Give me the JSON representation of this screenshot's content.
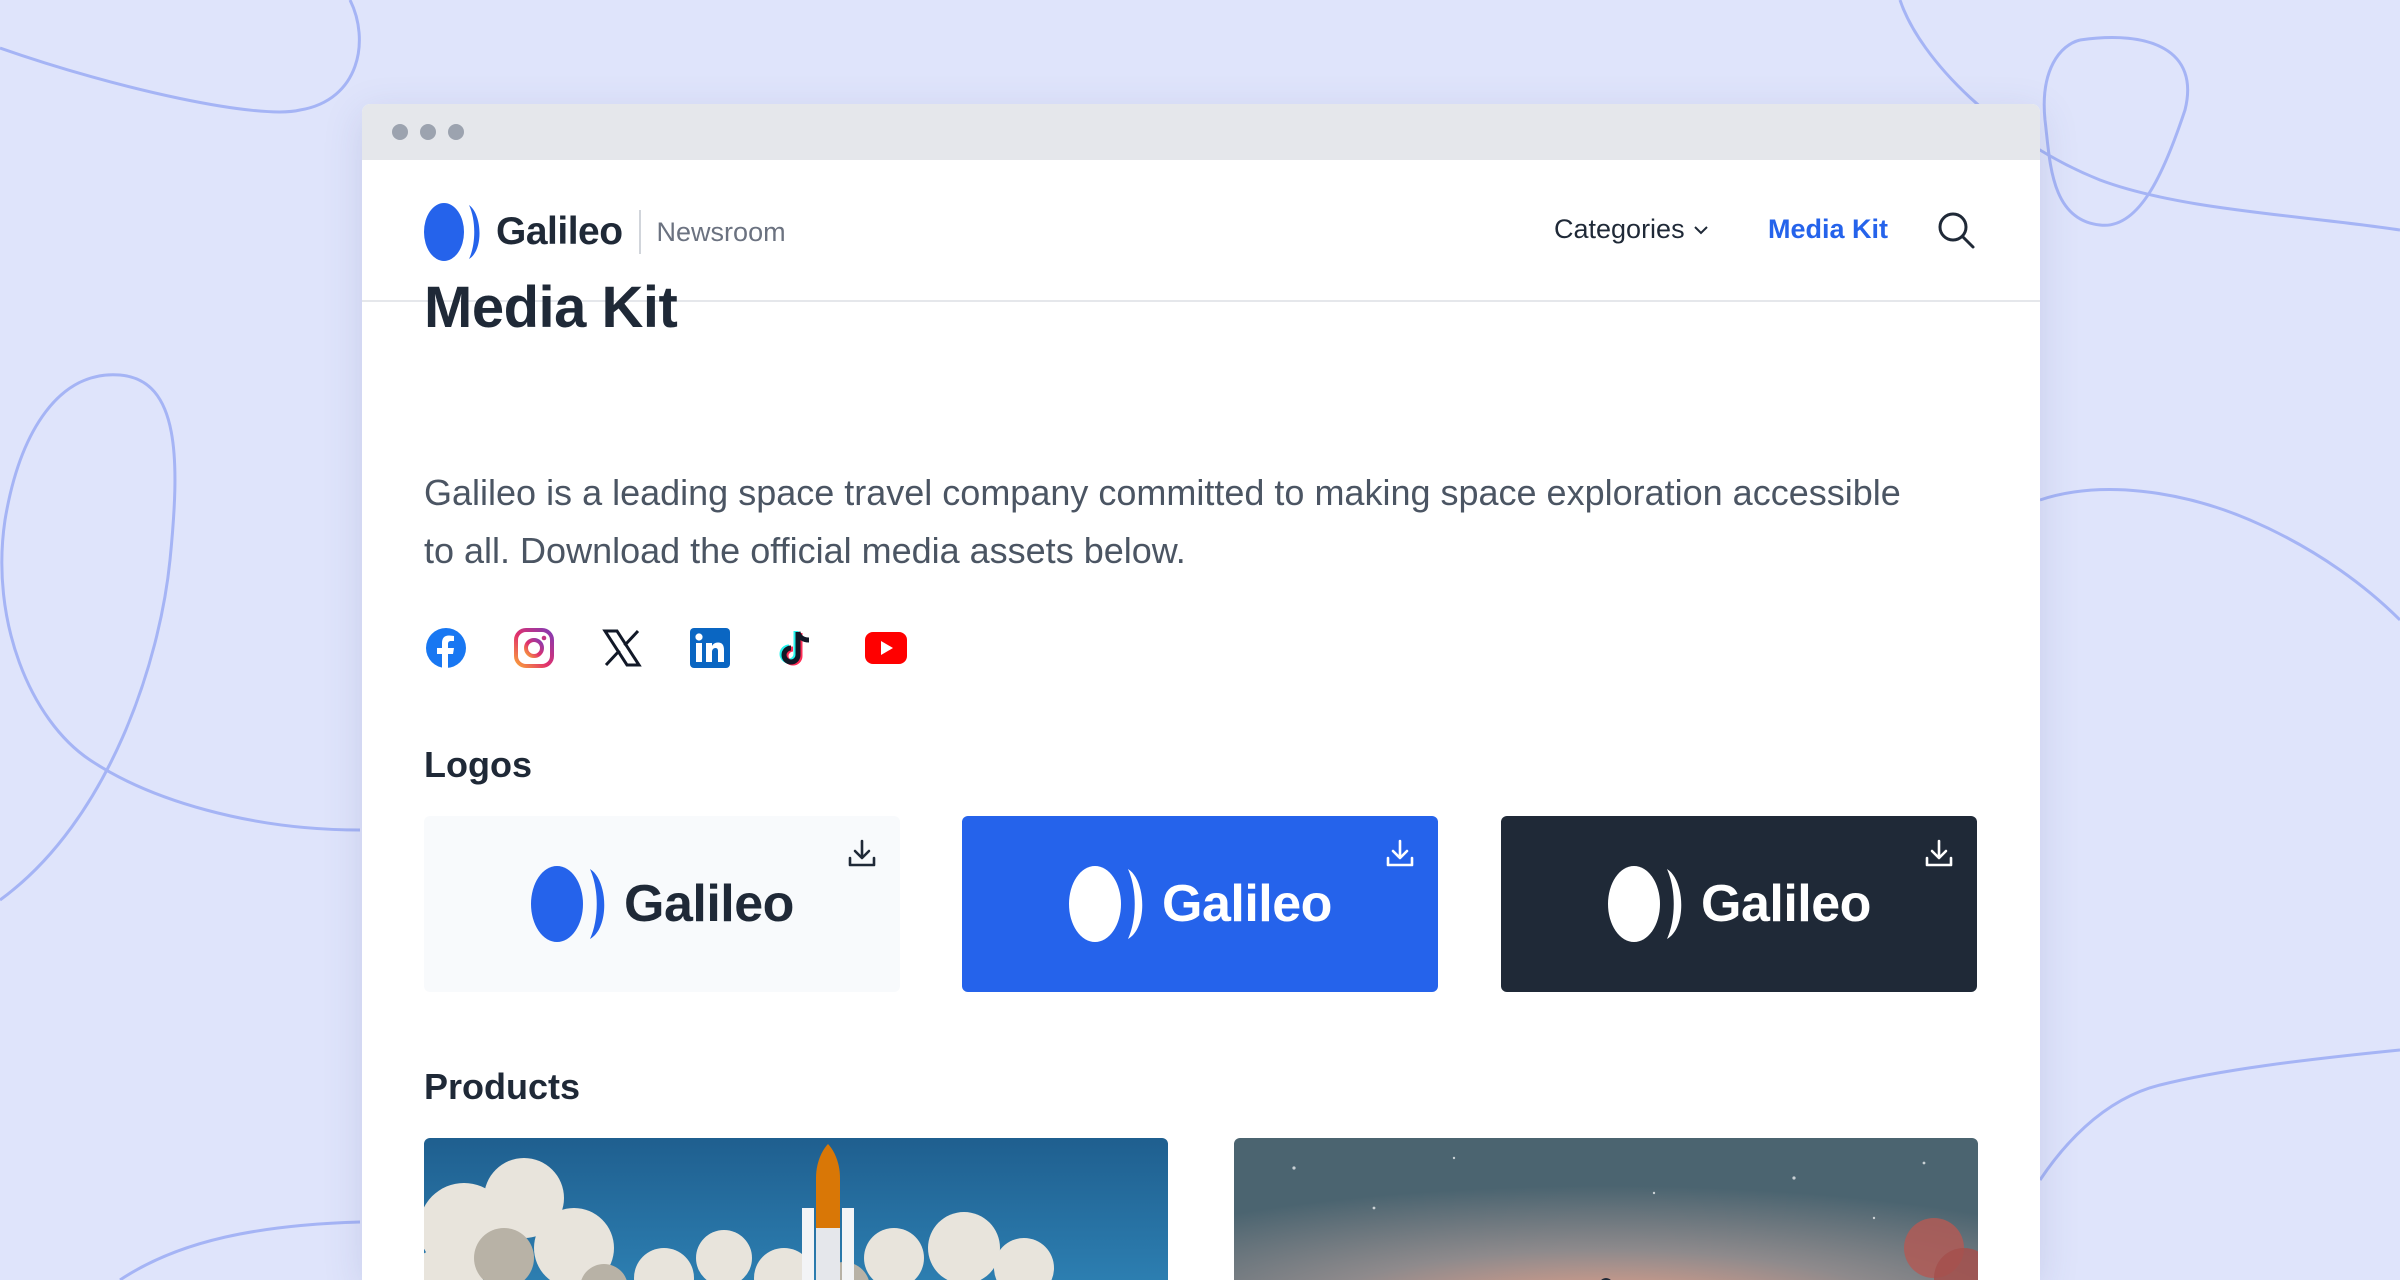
{
  "browser": {
    "dots": 3
  },
  "header": {
    "brand_name": "Galileo",
    "brand_sub": "Newsroom",
    "nav": {
      "categories_label": "Categories",
      "media_kit_label": "Media Kit"
    }
  },
  "main": {
    "title": "Media Kit",
    "description": "Galileo is a leading space travel company committed to making space exploration accessible to all. Download the official media assets below.",
    "socials": [
      {
        "icon": "facebook-icon"
      },
      {
        "icon": "instagram-icon"
      },
      {
        "icon": "x-icon"
      },
      {
        "icon": "linkedin-icon"
      },
      {
        "icon": "tiktok-icon"
      },
      {
        "icon": "youtube-icon"
      }
    ],
    "logos_heading": "Logos",
    "logos": [
      {
        "variant": "light",
        "name": "Galileo",
        "bg": "#f8fafc",
        "text": "#1f2937"
      },
      {
        "variant": "blue",
        "name": "Galileo",
        "bg": "#2563eb",
        "text": "#ffffff"
      },
      {
        "variant": "dark",
        "name": "Galileo",
        "bg": "#1f2937",
        "text": "#ffffff"
      }
    ],
    "products_heading": "Products"
  },
  "colors": {
    "accent": "#2563eb",
    "dark": "#1f2937",
    "background": "#dfe4fb"
  }
}
